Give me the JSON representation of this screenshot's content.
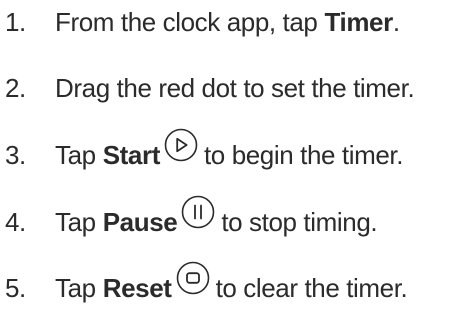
{
  "steps": [
    {
      "number": "1.",
      "before": "From the clock app, tap",
      "bold": "Timer",
      "after": "."
    },
    {
      "number": "2.",
      "text": "Drag the red dot to set the timer."
    },
    {
      "number": "3.",
      "before": "Tap",
      "bold": "Start",
      "icon": "play-icon",
      "after": "to begin the timer."
    },
    {
      "number": "4.",
      "before": "Tap",
      "bold": "Pause",
      "icon": "pause-icon",
      "after": "to stop timing."
    },
    {
      "number": "5.",
      "before": "Tap",
      "bold": "Reset",
      "icon": "stop-icon",
      "after": "to clear the timer."
    }
  ],
  "colors": {
    "text": "#2b2b2b",
    "icon": "#2b2b2b",
    "background": "#ffffff"
  }
}
